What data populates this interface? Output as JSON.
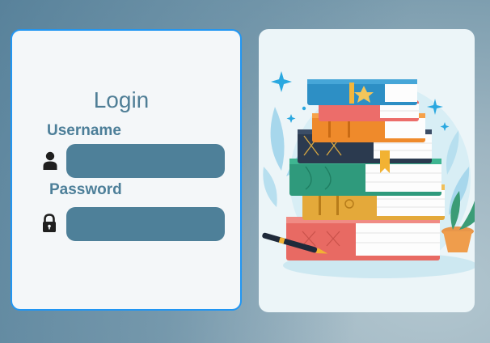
{
  "login": {
    "title": "Login",
    "username_label": "Username",
    "username_value": "",
    "password_label": "Password",
    "password_value": ""
  },
  "icons": {
    "username": "user-icon",
    "password": "lock-icon"
  },
  "illustration": "stack-of-books-illustration",
  "colors": {
    "card_border": "#2196f3",
    "input_fill": "#4e8099",
    "label_text": "#4d7f99"
  }
}
